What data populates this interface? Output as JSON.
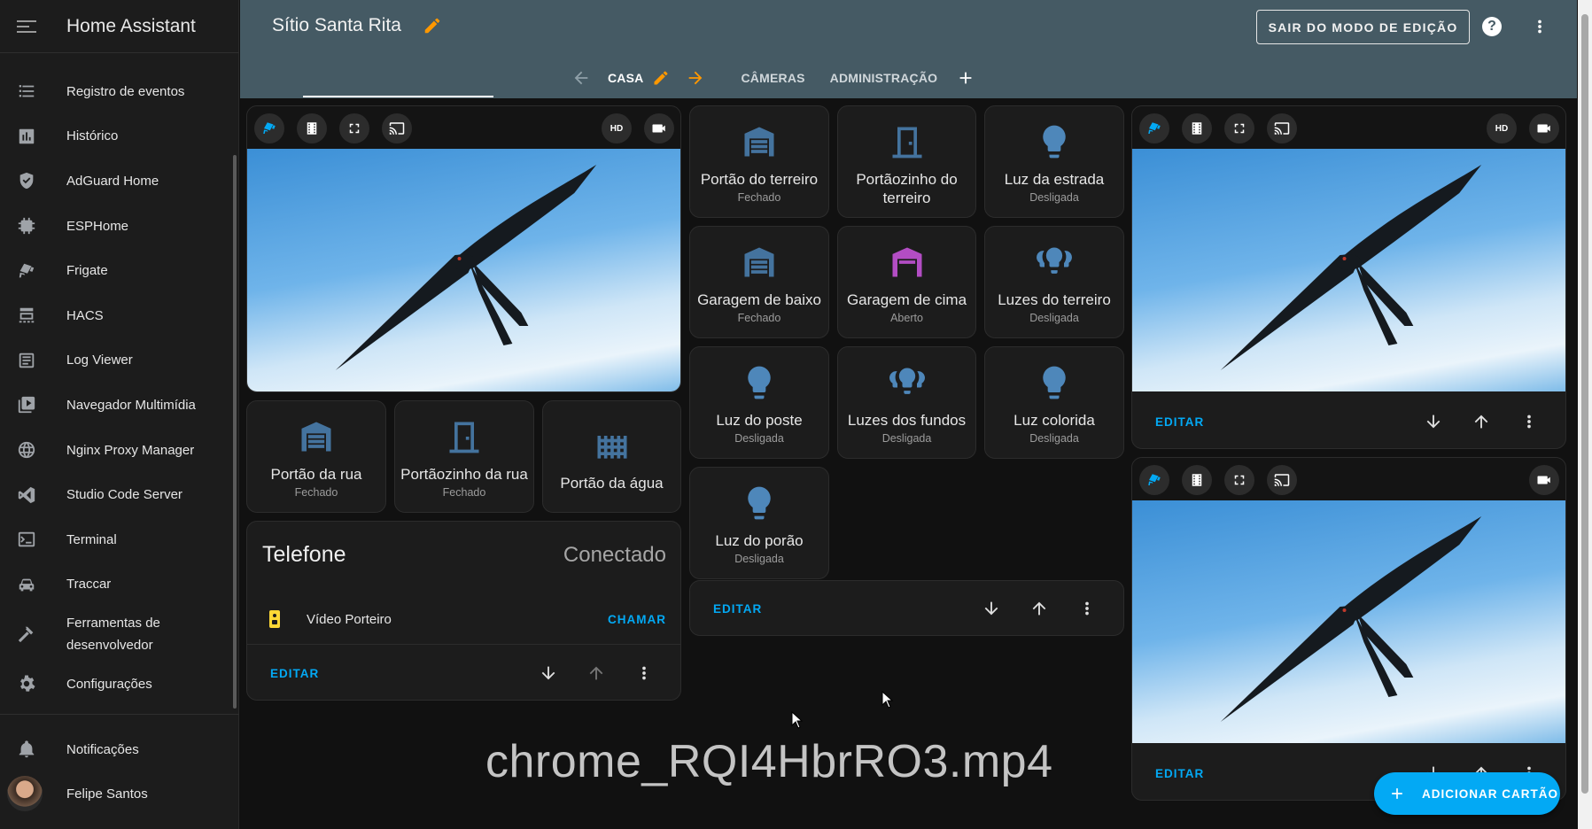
{
  "app": {
    "name": "Home Assistant"
  },
  "sidebar": {
    "items": [
      {
        "label": "Registro de eventos",
        "icon": "format-list-bulleted-icon"
      },
      {
        "label": "Histórico",
        "icon": "chart-box-icon"
      },
      {
        "label": "AdGuard Home",
        "icon": "shield-check-icon"
      },
      {
        "label": "ESPHome",
        "icon": "chip-icon"
      },
      {
        "label": "Frigate",
        "icon": "cctv-icon"
      },
      {
        "label": "HACS",
        "icon": "hacs-icon"
      },
      {
        "label": "Log Viewer",
        "icon": "text-box-icon"
      },
      {
        "label": "Navegador Multimídia",
        "icon": "play-box-multiple-icon"
      },
      {
        "label": "Nginx Proxy Manager",
        "icon": "web-icon"
      },
      {
        "label": "Studio Code Server",
        "icon": "vscode-icon"
      },
      {
        "label": "Terminal",
        "icon": "console-icon"
      },
      {
        "label": "Traccar",
        "icon": "car-icon"
      },
      {
        "label": "Ferramentas de desenvolvedor",
        "icon": "hammer-icon"
      },
      {
        "label": "Configurações",
        "icon": "cog-icon"
      }
    ],
    "notifications": "Notificações",
    "user": "Felipe Santos"
  },
  "header": {
    "title": "Sítio Santa Rita",
    "exit_button": "SAIR DO MODO DE EDIÇÃO",
    "tabs": [
      "CASA",
      "CÂMERAS",
      "ADMINISTRAÇÃO"
    ],
    "active_tab": "CASA"
  },
  "tiles_left": [
    {
      "name": "Portão da rua",
      "state": "Fechado",
      "icon": "garage-icon"
    },
    {
      "name": "Portãozinho da rua",
      "state": "Fechado",
      "icon": "door-icon"
    },
    {
      "name": "Portão da água",
      "state": "",
      "icon": "gate-icon"
    }
  ],
  "tiles_middle": [
    {
      "name": "Portão do terreiro",
      "state": "Fechado",
      "icon": "garage-icon"
    },
    {
      "name": "Portãozinho do terreiro",
      "state": "",
      "icon": "door-icon"
    },
    {
      "name": "Luz da estrada",
      "state": "Desligada",
      "icon": "lightbulb-icon"
    },
    {
      "name": "Garagem de baixo",
      "state": "Fechado",
      "icon": "garage-icon"
    },
    {
      "name": "Garagem de cima",
      "state": "Aberto",
      "icon": "garage-open-icon"
    },
    {
      "name": "Luzes do terreiro",
      "state": "Desligada",
      "icon": "lightbulb-group-icon"
    },
    {
      "name": "Luz do poste",
      "state": "Desligada",
      "icon": "lightbulb-icon"
    },
    {
      "name": "Luzes dos fundos",
      "state": "Desligada",
      "icon": "lightbulb-group-icon"
    },
    {
      "name": "Luz colorida",
      "state": "Desligada",
      "icon": "lightbulb-icon"
    },
    {
      "name": "Luz do porão",
      "state": "Desligada",
      "icon": "lightbulb-icon"
    }
  ],
  "phone_card": {
    "title": "Telefone",
    "status": "Conectado",
    "entity": "Vídeo Porteiro",
    "action": "CHAMAR"
  },
  "card_footer": {
    "edit": "EDITAR"
  },
  "camera": {
    "hd_label": "HD"
  },
  "fab": {
    "label": "ADICIONAR CARTÃO"
  },
  "overlay": {
    "watermark": "chrome_RQI4HbrRO3.mp4"
  },
  "colors": {
    "header": "#455a64",
    "accent": "#03a9f4",
    "orange": "#ff9800",
    "icon_blue": "#44739e",
    "bulb_blue": "#4e87ba",
    "purple": "#b34dc4",
    "intercom_yellow": "#fdd835"
  }
}
